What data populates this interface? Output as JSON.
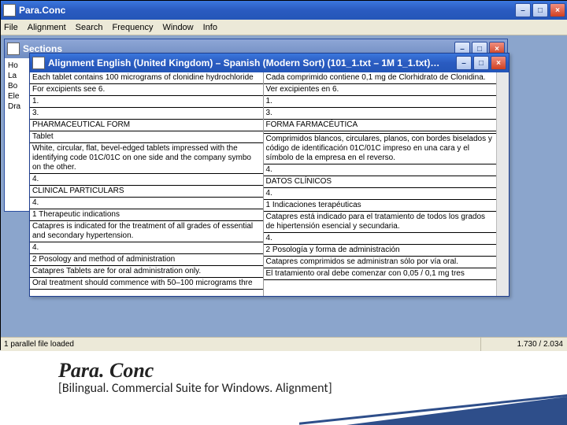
{
  "main": {
    "title": "Para.Conc",
    "menu": [
      "File",
      "Alignment",
      "Search",
      "Frequency",
      "Window",
      "Info"
    ],
    "status_left": "1 parallel file loaded",
    "status_right": "1.730 / 2.034"
  },
  "sections": {
    "title": "Sections",
    "lines": [
      "Ho",
      "La",
      "Bo",
      "Ele",
      "Dra"
    ]
  },
  "align": {
    "title": "Alignment English (United Kingdom) – Spanish (Modern Sort) (101_1.txt – 1M 1_1.txt)…",
    "left": [
      "Each tablet contains 100 micrograms of clonidine hydrochloride",
      "For excipients see 6.",
      "1.",
      "3.",
      "PHARMACEUTICAL FORM",
      "Tablet",
      "White, circular, flat, bevel-edged tablets impressed with the identifying code 01C/01C on one side and the company symbo on the other.",
      "4.",
      "CLINICAL PARTICULARS",
      "4.",
      "1 Therapeutic indications",
      "Catapres is indicated for the treatment of all grades of essential and secondary hypertension.",
      "4.",
      "2 Posology and method of administration",
      "Catapres Tablets are for oral administration only.",
      "Oral treatment should commence with 50–100 micrograms thre"
    ],
    "right": [
      "Cada comprimido contiene 0,1 mg de Clorhidrato de Clonidina.",
      "Ver excipientes en 6.",
      "1.",
      "3.",
      "FORMA FARMACÉUTICA",
      "",
      "Comprimidos blancos, circulares, planos, con bordes biselados y código de identificación 01C/01C impreso en una cara y el símbolo de la empresa en el reverso.",
      "4.",
      "DATOS CLÍNICOS",
      "4.",
      "1 Indicaciones terapéuticas",
      "Catapres está indicado para el tratamiento de todos los grados de hipertensión esencial y secundaria.",
      "4.",
      "2 Posología y forma de administración",
      "Catapres comprimidos se administran sólo por vía oral.",
      "El tratamiento oral debe comenzar con 0,05 / 0,1 mg tres"
    ]
  },
  "caption": {
    "title": "Para. Conc",
    "sub": "[Bilingual. Commercial Suite for Windows. Alignment]"
  },
  "labels": {
    "min": "–",
    "max": "□",
    "close": "×"
  }
}
